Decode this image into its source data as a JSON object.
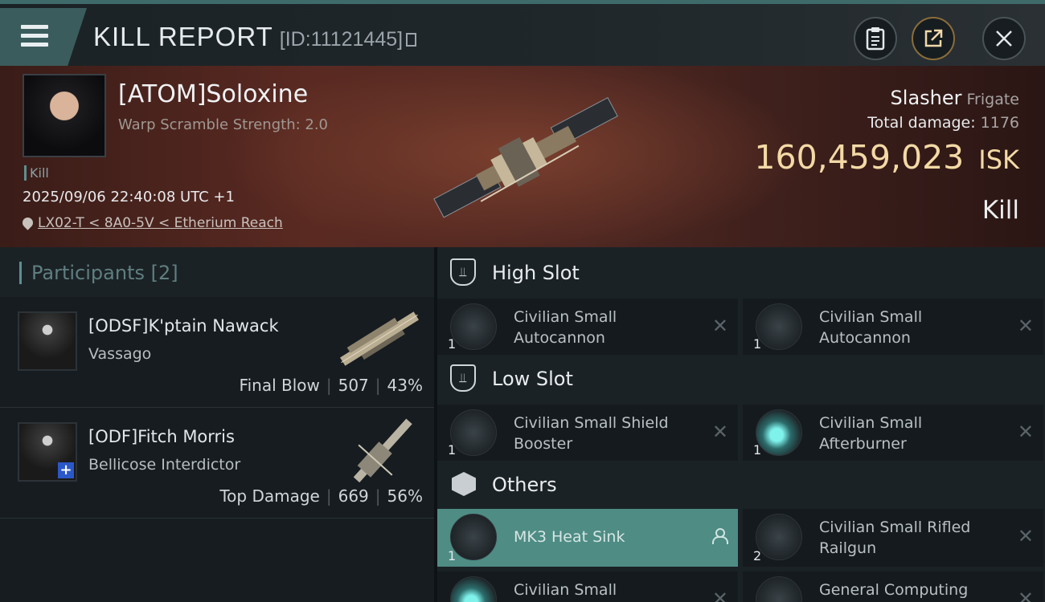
{
  "header": {
    "title": "KILL REPORT",
    "report_id": "[ID:11121445]",
    "icons": [
      "menu-icon",
      "copy-icon",
      "clipboard-icon",
      "share-icon",
      "close-icon"
    ]
  },
  "victim": {
    "name": "[ATOM]Soloxine",
    "warp_scramble": "Warp Scramble Strength: 2.0",
    "tag": "Kill",
    "datetime": "2025/09/06 22:40:08 UTC +1",
    "location": "LX02-T < 8A0-5V < Etherium Reach",
    "ship_name": "Slasher",
    "ship_class": "Frigate",
    "total_damage_label": "Total damage:",
    "total_damage_value": "1176",
    "isk_value": "160,459,023",
    "isk_unit": "ISK",
    "verdict": "Kill"
  },
  "participants": {
    "title": "Participants",
    "count": "[2]",
    "rows": [
      {
        "name": "[ODSF]K'ptain Nawack",
        "ship": "Vassago",
        "role": "Final Blow",
        "damage": "507",
        "percent": "43%"
      },
      {
        "name": "[ODF]Fitch Morris",
        "ship": "Bellicose Interdictor",
        "role": "Top Damage",
        "damage": "669",
        "percent": "56%"
      }
    ]
  },
  "slots": {
    "high": {
      "label": "High Slot",
      "items": [
        {
          "qty": "1",
          "name": "Civilian Small Autocannon"
        },
        {
          "qty": "1",
          "name": "Civilian Small Autocannon"
        }
      ]
    },
    "low": {
      "label": "Low Slot",
      "items": [
        {
          "qty": "1",
          "name": "Civilian Small Shield Booster"
        },
        {
          "qty": "1",
          "name": "Civilian Small Afterburner"
        }
      ]
    },
    "others": {
      "label": "Others",
      "items": [
        {
          "qty": "1",
          "name": "MK3 Heat Sink"
        },
        {
          "qty": "2",
          "name": "Civilian Small Rifled Railgun"
        },
        {
          "qty": "",
          "name": "Civilian Small"
        },
        {
          "qty": "",
          "name": "General Computing"
        }
      ]
    }
  },
  "colors": {
    "accent_teal": "#5d8f8f",
    "isk_gold": "#f3d9a5",
    "highlight_row": "#4e8c84"
  }
}
